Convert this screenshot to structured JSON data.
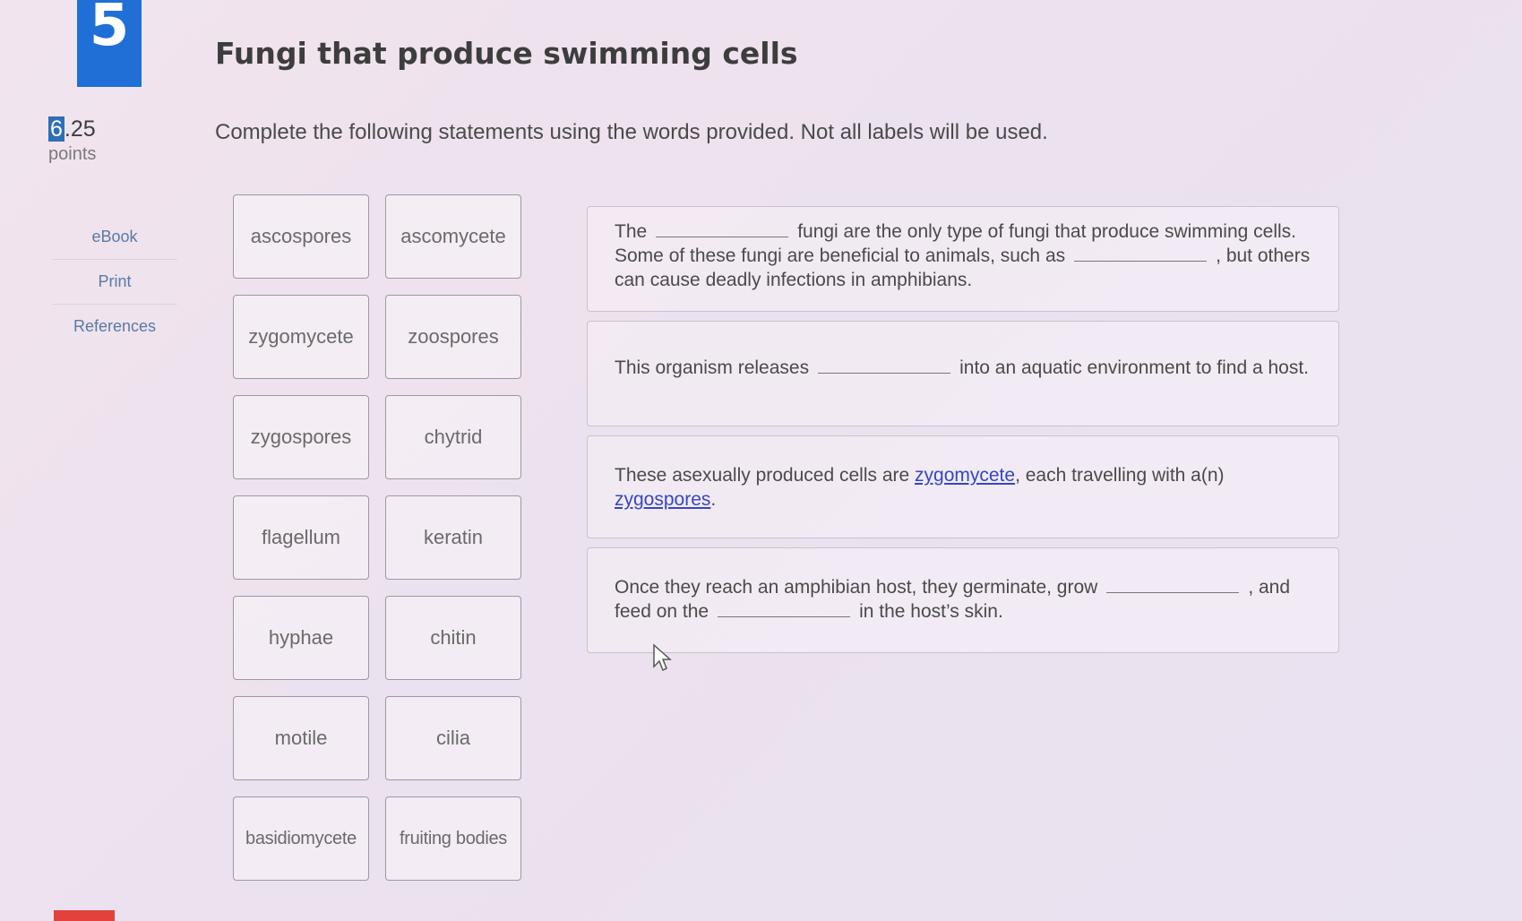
{
  "question": {
    "number": "5",
    "title": "Fungi that produce swimming cells",
    "points_value_highlight": "6",
    "points_value_rest": ".25",
    "points_label": "points",
    "instructions": "Complete the following statements using the words provided. Not all labels will be used."
  },
  "side_nav": {
    "ebook": "eBook",
    "print": "Print",
    "references": "References"
  },
  "labels": [
    "ascospores",
    "ascomycete",
    "zygomycete",
    "zoospores",
    "zygospores",
    "chytrid",
    "flagellum",
    "keratin",
    "hyphae",
    "chitin",
    "motile",
    "cilia",
    "basidiomycete",
    "fruiting bodies"
  ],
  "statements": {
    "s1": {
      "part1": "The",
      "part2": "fungi are the only type of fungi that produce swimming cells. Some of these fungi are beneficial to animals, such as",
      "part3": ",",
      "part4": "but others can cause deadly infections in amphibians."
    },
    "s2": {
      "part1": "This organism releases",
      "part2": "into an aquatic environment to find a host."
    },
    "s3": {
      "part1": "These asexually produced cells are",
      "filled1": "zygomycete",
      "part2": ", each travelling with a(n)",
      "filled2": "zygospores",
      "part3": "."
    },
    "s4": {
      "part1": "Once they reach an amphibian host, they germinate, grow",
      "part2": ",",
      "part3": "and feed on the",
      "part4": "in the host’s skin."
    }
  },
  "colors": {
    "badge": "#1f6fd6",
    "link": "#5a7aa8",
    "filled_answer": "#3447c6",
    "accent_red": "#e2413c"
  }
}
